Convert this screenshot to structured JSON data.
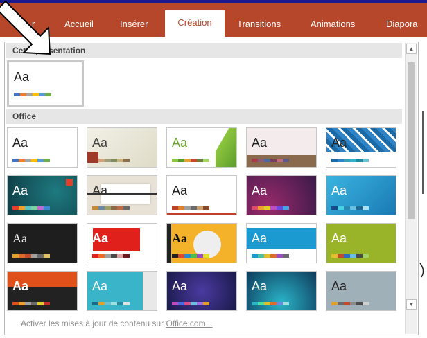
{
  "ribbon": {
    "tabs": [
      {
        "label": "r",
        "active": false
      },
      {
        "label": "Accueil",
        "active": false
      },
      {
        "label": "Insérer",
        "active": false
      },
      {
        "label": "Création",
        "active": true
      },
      {
        "label": "Transitions",
        "active": false
      },
      {
        "label": "Animations",
        "active": false
      },
      {
        "label": "Diapora",
        "active": false
      }
    ]
  },
  "gallery": {
    "section_current": "Cette présentation",
    "section_office": "Office",
    "thumb_text": "Aa",
    "footer_prefix": "Activer les mises à jour de contenu sur ",
    "footer_link": "Office.com...",
    "scroll_up": "▲",
    "scroll_down": "▼"
  },
  "colors": {
    "ribbon": "#b7472a",
    "frame": "#1a1a8c"
  },
  "icons": [
    "arrow-pointer-annotation",
    "scroll-up-icon",
    "scroll-down-icon"
  ]
}
